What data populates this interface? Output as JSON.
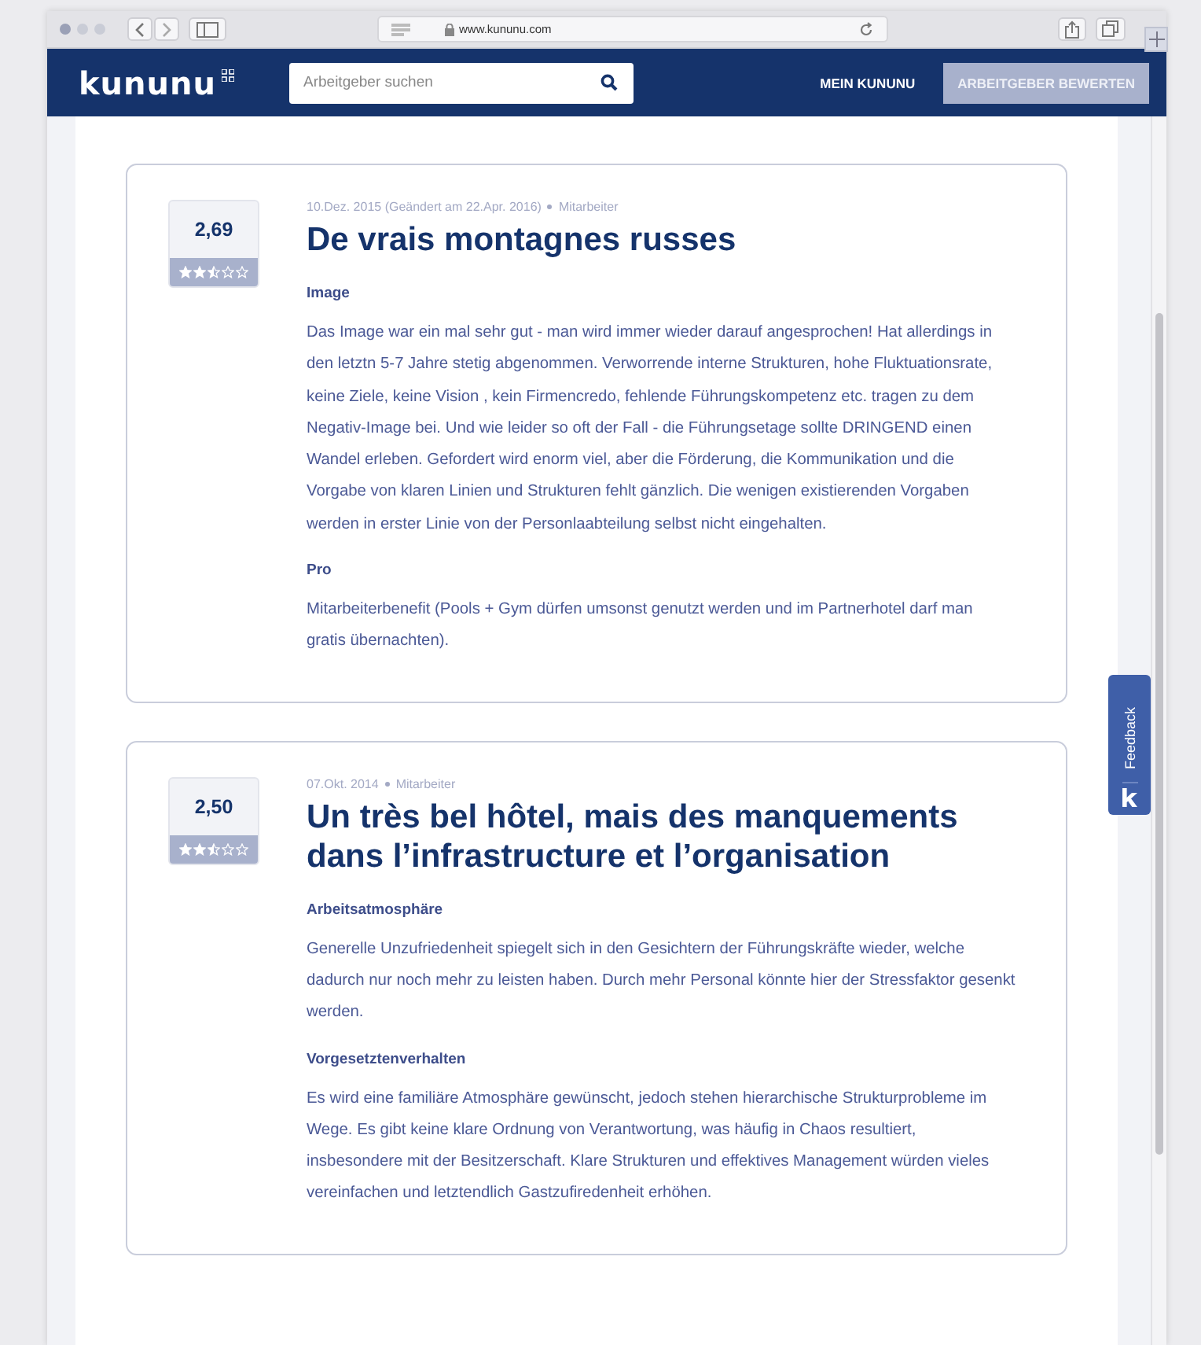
{
  "browser": {
    "url": "www.kununu.com"
  },
  "header": {
    "logo": "kununu",
    "search": {
      "placeholder": "Arbeitgeber suchen"
    },
    "nav": [
      {
        "label": "MEIN KUNUNU",
        "kind": "link"
      },
      {
        "label": "ARBEITGEBER BEWERTEN",
        "kind": "button"
      }
    ]
  },
  "reviews": [
    {
      "score": "2,69",
      "stars": 2.5,
      "date": "10.Dez. 2015 (Geändert am 22.Apr. 2016)",
      "role": "Mitarbeiter",
      "title": "De vrais montagnes russes",
      "sections": [
        {
          "heading": "Image",
          "text": "Das Image war ein mal sehr gut - man wird immer wieder darauf angesprochen! Hat allerdings in den letztn 5-7 Jahre stetig abgenommen. Verworrende interne Strukturen, hohe Fluktuationsrate, keine Ziele, keine Vision , kein Firmencredo, fehlende Führungskompetenz etc. tragen zu dem Negativ-Image bei. Und wie leider so oft der Fall - die Führungsetage sollte DRINGEND einen Wandel erleben. Gefordert wird enorm viel, aber die Förderung, die Kommunikation und die Vorgabe von klaren Linien und Strukturen fehlt gänzlich. Die wenigen existierenden Vorgaben werden in erster Linie von der Personlaabteilung selbst nicht eingehalten."
        },
        {
          "heading": "Pro",
          "text": "Mitarbeiterbenefit (Pools + Gym dürfen umsonst genutzt werden und im Partnerhotel darf man gratis übernachten)."
        }
      ]
    },
    {
      "score": "2,50",
      "stars": 2.5,
      "date": "07.Okt. 2014",
      "role": "Mitarbeiter",
      "title": "Un très bel hôtel, mais des manquements dans l’infrastructure et l’organisation",
      "sections": [
        {
          "heading": "Arbeitsatmosphäre",
          "text": "Generelle Unzufriedenheit spiegelt sich in den Gesichtern der Führungskräfte wieder, welche dadurch nur noch mehr zu leisten haben. Durch mehr Personal könnte hier der Stressfaktor gesenkt werden."
        },
        {
          "heading": "Vorgesetztenverhalten",
          "text": "Es wird eine familiäre Atmosphäre gewünscht, jedoch stehen hierarchische Strukturprobleme im Wege. Es gibt keine klare Ordnung von Verantwortung, was häufig in Chaos resultiert, insbesondere mit der Besitzerschaft. Klare Strukturen und effektives Management würden vieles vereinfachen und letztendlich Gastzufiredenheit erhöhen."
        }
      ]
    }
  ],
  "feedback": {
    "label": "Feedback"
  }
}
